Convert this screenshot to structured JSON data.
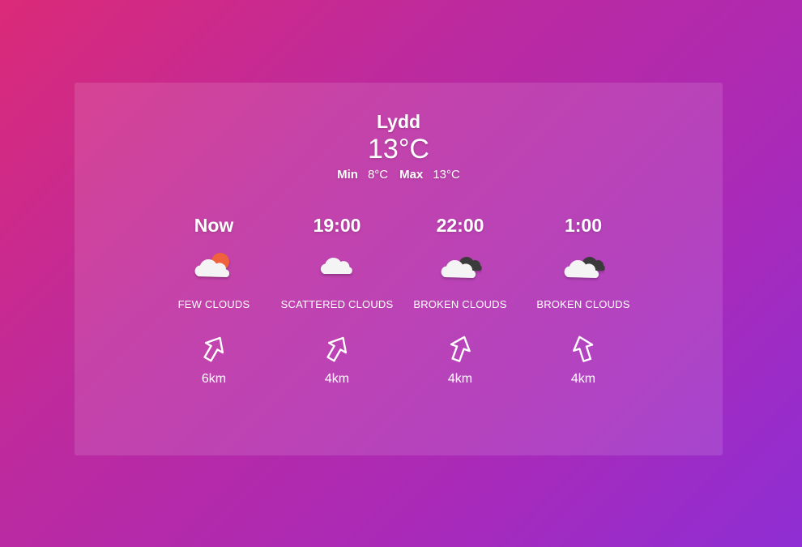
{
  "location": {
    "city": "Lydd",
    "current_temp": "13°C",
    "min_label": "Min",
    "min_value": "8°C",
    "max_label": "Max",
    "max_value": "13°C"
  },
  "forecast": [
    {
      "time": "Now",
      "icon": "few-clouds-icon",
      "description": "FEW CLOUDS",
      "wind": "6km"
    },
    {
      "time": "19:00",
      "icon": "scattered-clouds-icon",
      "description": "SCATTERED CLOUDS",
      "wind": "4km"
    },
    {
      "time": "22:00",
      "icon": "broken-clouds-icon",
      "description": "BROKEN CLOUDS",
      "wind": "4km"
    },
    {
      "time": "1:00",
      "icon": "broken-clouds-icon",
      "description": "BROKEN CLOUDS",
      "wind": "4km"
    }
  ],
  "colors": {
    "gradient_start": "#db2a78",
    "gradient_end": "#8f2ed4",
    "sun": "#f0623c",
    "cloud_light": "#f4f4f4",
    "cloud_dark": "#3a3a3a"
  }
}
